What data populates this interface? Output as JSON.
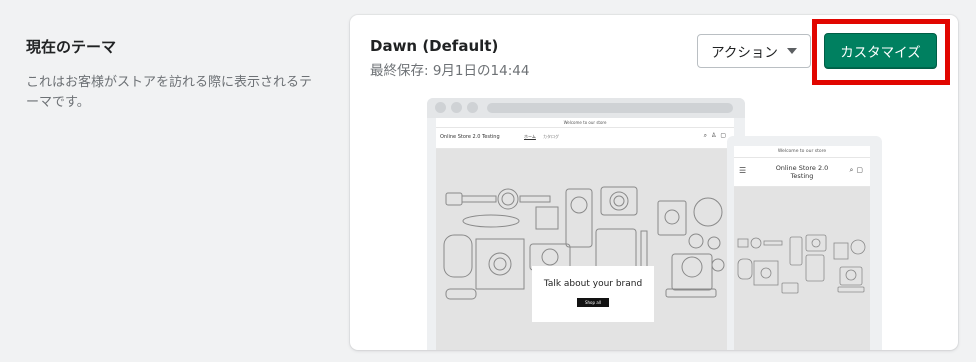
{
  "section": {
    "title": "現在のテーマ",
    "description": "これはお客様がストアを訪れる際に表示されるテーマです。"
  },
  "theme": {
    "name": "Dawn (Default)",
    "last_saved": "最終保存: 9月1日の14:44"
  },
  "buttons": {
    "actions_label": "アクション",
    "customize_label": "カスタマイズ"
  },
  "colors": {
    "primary": "#008060",
    "highlight": "#e10600",
    "background": "#f1f2f3"
  },
  "preview": {
    "announcement": "Welcome to our store",
    "store_name": "Online Store 2.0 Testing",
    "nav_home": "ホーム",
    "nav_catalog": "カタログ",
    "hero_title": "Talk about your brand",
    "hero_button": "Shop all",
    "mobile_store_name": "Online Store 2.0 Testing"
  }
}
